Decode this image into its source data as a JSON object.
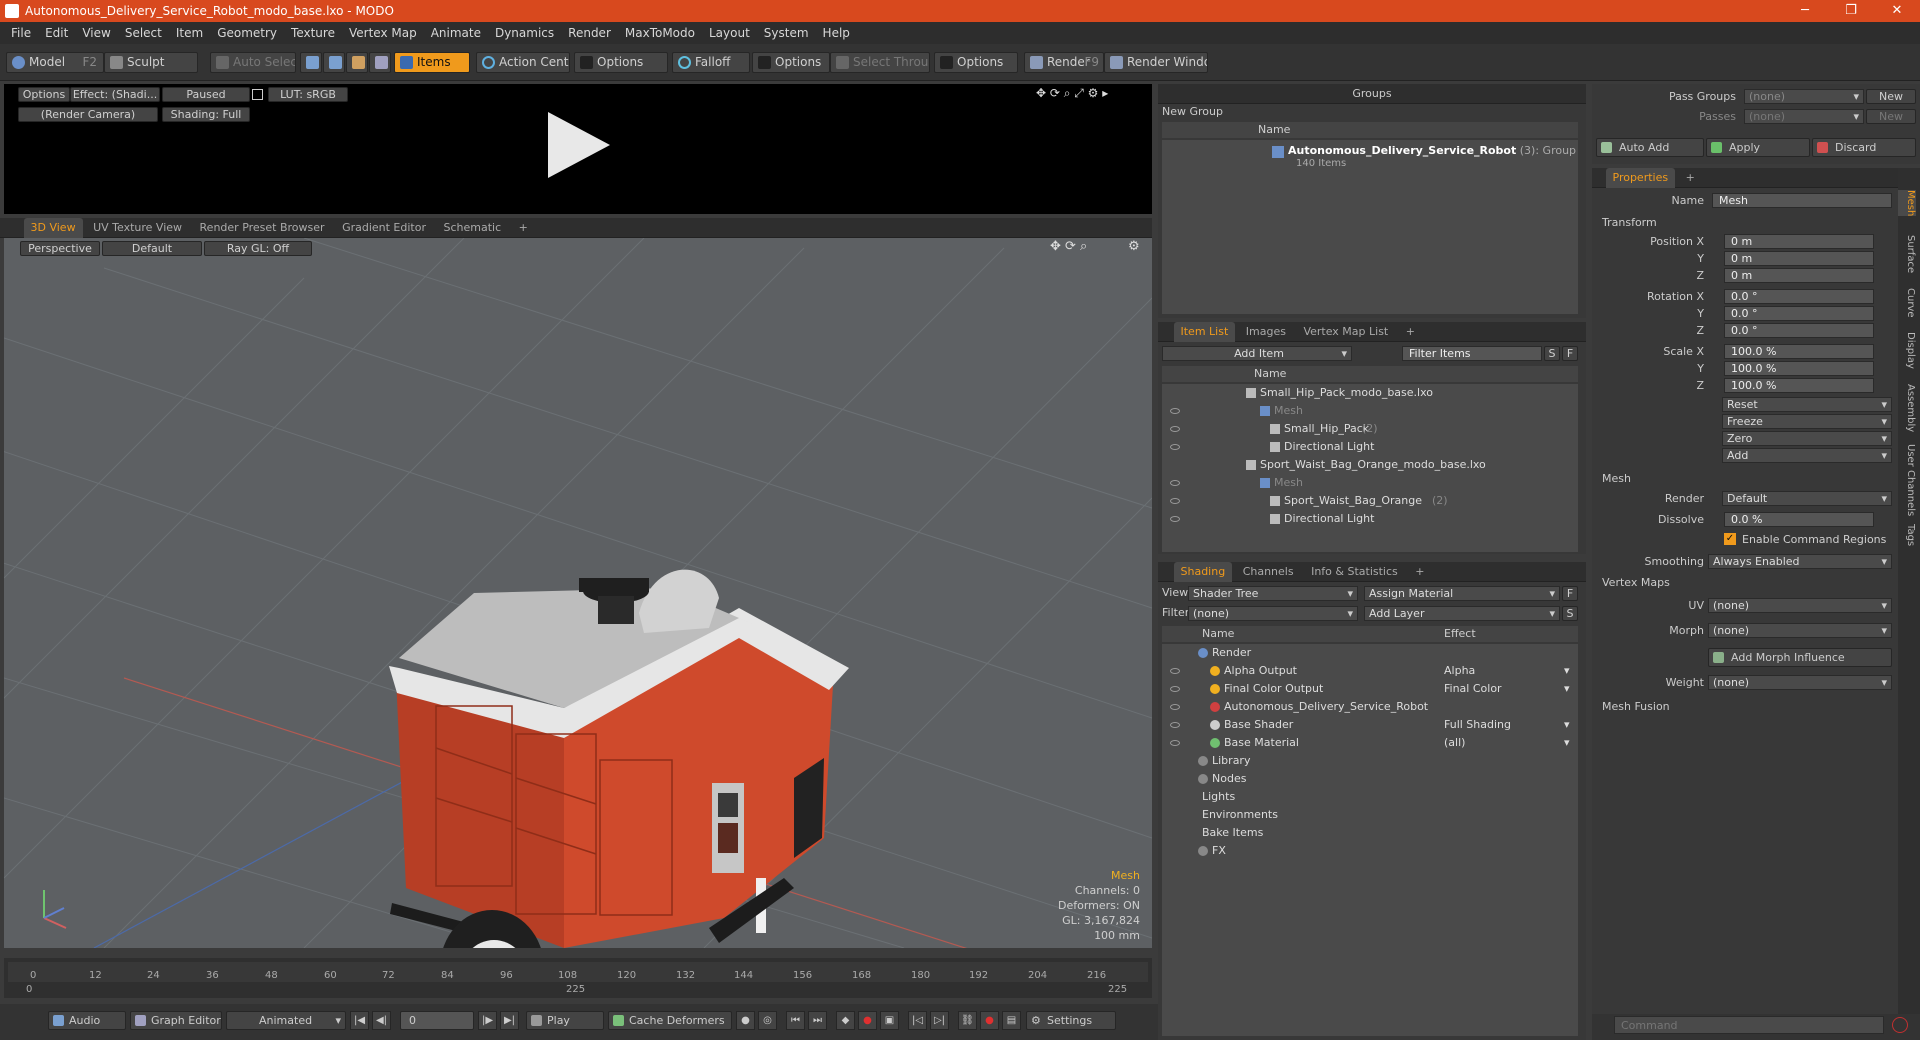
{
  "window": {
    "title": "Autonomous_Delivery_Service_Robot_modo_base.lxo - MODO"
  },
  "menu": [
    "File",
    "Edit",
    "View",
    "Select",
    "Item",
    "Geometry",
    "Texture",
    "Vertex Map",
    "Animate",
    "Dynamics",
    "Render",
    "MaxToModo",
    "Layout",
    "System",
    "Help"
  ],
  "toolbar": {
    "model": "Model",
    "model_key": "F2",
    "sculpt": "Sculpt",
    "auto_select": "Auto Select",
    "items": "Items",
    "action_center": "Action Center",
    "options1": "Options",
    "falloff": "Falloff",
    "options2": "Options",
    "select_through": "Select Through",
    "options3": "Options",
    "render": "Render",
    "render_key": "F9",
    "render_window": "Render Window"
  },
  "preview": {
    "options": "Options",
    "effect": "Effect: (Shadi...",
    "paused": "Paused",
    "lut": "LUT: sRGB",
    "camera": "(Render Camera)",
    "shading": "Shading: Full"
  },
  "viewport_tabs": [
    "3D View",
    "UV Texture View",
    "Render Preset Browser",
    "Gradient Editor",
    "Schematic"
  ],
  "viewport": {
    "perspective": "Perspective",
    "default": "Default",
    "raygl": "Ray GL: Off",
    "info": {
      "type": "Mesh",
      "channels": "Channels: 0",
      "deformers": "Deformers: ON",
      "gl": "GL: 3,167,824",
      "scale": "100 mm"
    },
    "colors": {
      "body": "#cf4a2c",
      "roof": "#bdbdbd",
      "tire": "#1f1f1f",
      "grid": "#6c7276"
    }
  },
  "timeline": {
    "ticks": [
      "0",
      "12",
      "24",
      "36",
      "48",
      "60",
      "72",
      "84",
      "96",
      "108",
      "120",
      "132",
      "144",
      "156",
      "168",
      "180",
      "192",
      "204",
      "216"
    ],
    "start": "0",
    "mid": "225",
    "end": "225"
  },
  "bottombar": {
    "audio": "Audio",
    "graph": "Graph Editor",
    "animated": "Animated",
    "frame": "0",
    "play": "Play",
    "cache": "Cache Deformers",
    "settings": "Settings"
  },
  "groups": {
    "title": "Groups",
    "new_group": "New Group",
    "col_name": "Name",
    "item_name": "Autonomous_Delivery_Service_Robot",
    "item_count": "(3)",
    "item_type": ": Group",
    "item_sub": "140 Items"
  },
  "itemlist": {
    "tabs": [
      "Item List",
      "Images",
      "Vertex Map List"
    ],
    "add_item": "Add Item",
    "filter": "Filter Items",
    "s": "S",
    "f": "F",
    "col_name": "Name",
    "rows": [
      {
        "label": "Small_Hip_Pack_modo_base.lxo",
        "extra": ""
      },
      {
        "label": "Mesh",
        "extra": ""
      },
      {
        "label": "Small_Hip_Pack",
        "extra": "(2)"
      },
      {
        "label": "Directional Light",
        "extra": ""
      },
      {
        "label": "Sport_Waist_Bag_Orange_modo_base.lxo",
        "extra": ""
      },
      {
        "label": "Mesh",
        "extra": ""
      },
      {
        "label": "Sport_Waist_Bag_Orange",
        "extra": "(2)"
      },
      {
        "label": "Directional Light",
        "extra": ""
      }
    ]
  },
  "shading": {
    "tabs": [
      "Shading",
      "Channels",
      "Info & Statistics"
    ],
    "view_label": "View",
    "view_value": "Shader Tree",
    "assign": "Assign Material",
    "f": "F",
    "filter_label": "Filter",
    "filter_value": "(none)",
    "add_layer": "Add Layer",
    "s": "S",
    "col_name": "Name",
    "col_effect": "Effect",
    "rows": [
      {
        "name": "Render",
        "effect": ""
      },
      {
        "name": "Alpha Output",
        "effect": "Alpha"
      },
      {
        "name": "Final Color Output",
        "effect": "Final Color"
      },
      {
        "name": "Autonomous_Delivery_Service_Robot",
        "effect": ""
      },
      {
        "name": "Base Shader",
        "effect": "Full Shading"
      },
      {
        "name": "Base Material",
        "effect": "(all)"
      },
      {
        "name": "Library",
        "effect": ""
      },
      {
        "name": "Nodes",
        "effect": ""
      },
      {
        "name": "Lights",
        "effect": ""
      },
      {
        "name": "Environments",
        "effect": ""
      },
      {
        "name": "Bake Items",
        "effect": ""
      },
      {
        "name": "FX",
        "effect": ""
      }
    ]
  },
  "passes": {
    "pass_groups": "Pass Groups",
    "passes": "Passes",
    "none": "(none)",
    "new": "New",
    "auto_add": "Auto Add",
    "apply": "Apply",
    "discard": "Discard"
  },
  "properties": {
    "tab": "Properties",
    "name_label": "Name",
    "name_value": "Mesh",
    "transform": "Transform",
    "position_x": "Position X",
    "rotation_x": "Rotation X",
    "scale_x": "Scale X",
    "y": "Y",
    "z": "Z",
    "pos": [
      "0 m",
      "0 m",
      "0 m"
    ],
    "rot": [
      "0.0 °",
      "0.0 °",
      "0.0 °"
    ],
    "scale": [
      "100.0 %",
      "100.0 %",
      "100.0 %"
    ],
    "reset": "Reset",
    "freeze": "Freeze",
    "zero": "Zero",
    "add": "Add",
    "mesh": "Mesh",
    "render_label": "Render",
    "render_value": "Default",
    "dissolve_label": "Dissolve",
    "dissolve_value": "0.0 %",
    "enable_cmd": "Enable Command Regions",
    "smoothing_label": "Smoothing",
    "smoothing_value": "Always Enabled",
    "vertex_maps": "Vertex Maps",
    "uv_label": "UV",
    "uv_value": "(none)",
    "morph_label": "Morph",
    "morph_value": "(none)",
    "add_morph": "Add Morph Influence",
    "weight_label": "Weight",
    "weight_value": "(none)",
    "mesh_fusion": "Mesh Fusion"
  },
  "side_tabs": [
    "Mesh",
    "Surface",
    "Curve",
    "Display",
    "Assembly",
    "User Channels",
    "Tags"
  ],
  "command": {
    "placeholder": "Command"
  }
}
